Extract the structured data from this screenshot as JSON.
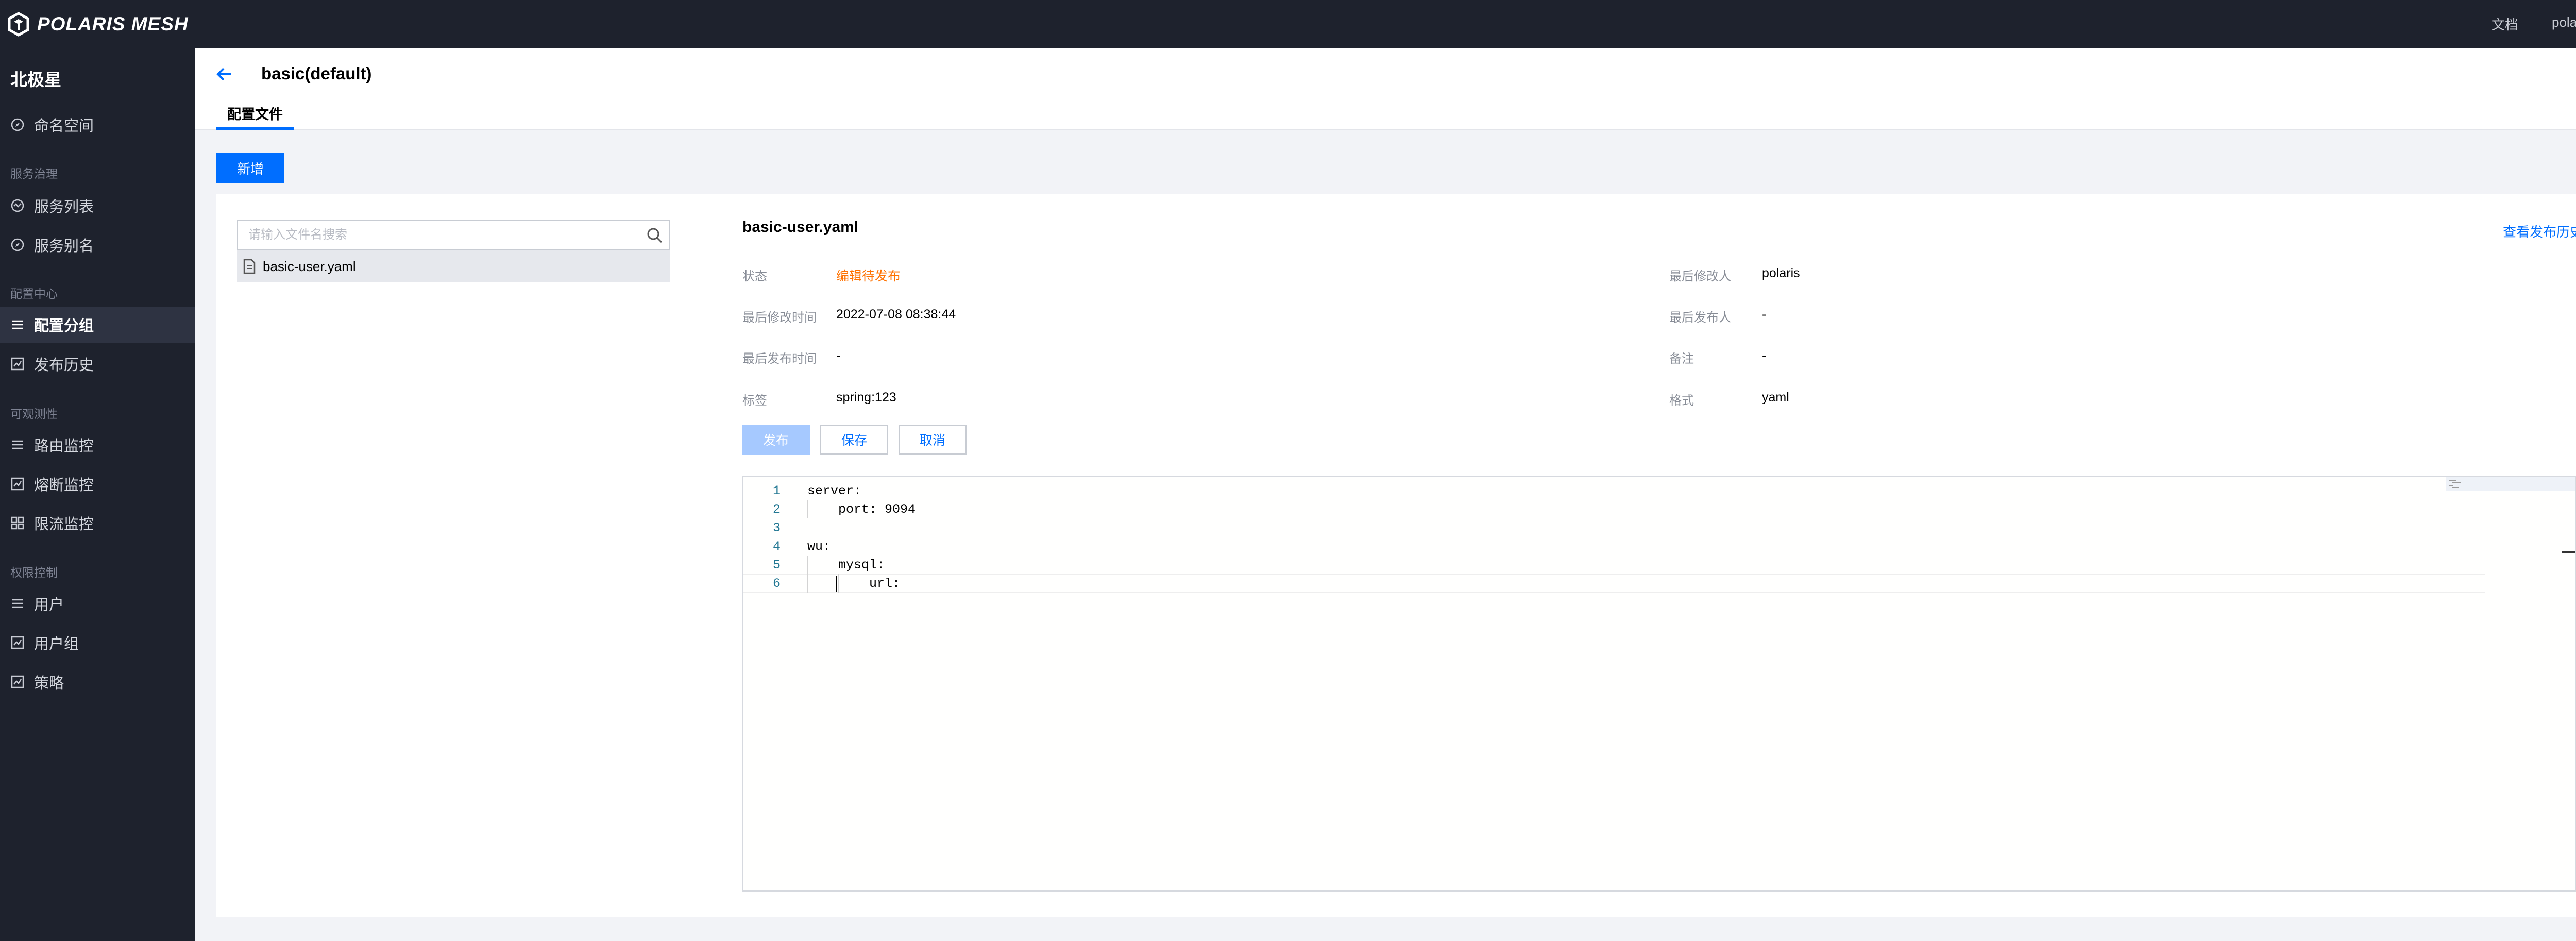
{
  "topbar": {
    "logo_text": "POLARIS MESH",
    "links": [
      "文档",
      "pola"
    ]
  },
  "sidebar": {
    "title": "北极星",
    "items": [
      {
        "label": "命名空间",
        "icon": "compass-icon",
        "section": null
      },
      {
        "label": "服务列表",
        "icon": "service-list-icon",
        "section": "服务治理"
      },
      {
        "label": "服务别名",
        "icon": "compass-icon",
        "section": null
      },
      {
        "label": "配置分组",
        "icon": "menu-list-icon",
        "section": "配置中心",
        "active": true
      },
      {
        "label": "发布历史",
        "icon": "chart-box-icon",
        "section": null
      },
      {
        "label": "路由监控",
        "icon": "menu-list-icon",
        "section": "可观测性"
      },
      {
        "label": "熔断监控",
        "icon": "chart-box-icon",
        "section": null
      },
      {
        "label": "限流监控",
        "icon": "grid-icon",
        "section": null
      },
      {
        "label": "用户",
        "icon": "menu-list-icon",
        "section": "权限控制"
      },
      {
        "label": "用户组",
        "icon": "chart-box-icon",
        "section": null
      },
      {
        "label": "策略",
        "icon": "chart-box-icon",
        "section": null
      }
    ],
    "sections": [
      "服务治理",
      "配置中心",
      "可观测性",
      "权限控制"
    ]
  },
  "header": {
    "title": "basic(default)",
    "tab": "配置文件"
  },
  "toolbar": {
    "add_label": "新增"
  },
  "file_list": {
    "search_placeholder": "请输入文件名搜索",
    "files": [
      "basic-user.yaml"
    ]
  },
  "detail": {
    "file_name": "basic-user.yaml",
    "history_link": "查看发布历史",
    "fields": {
      "status_label": "状态",
      "status_value": "编辑待发布",
      "modified_time_label": "最后修改时间",
      "modified_time_value": "2022-07-08 08:38:44",
      "published_time_label": "最后发布时间",
      "published_time_value": "-",
      "tags_label": "标签",
      "tags_value": "spring:123",
      "modifier_label": "最后修改人",
      "modifier_value": "polaris",
      "publisher_label": "最后发布人",
      "publisher_value": "-",
      "comment_label": "备注",
      "comment_value": "-",
      "format_label": "格式",
      "format_value": "yaml"
    },
    "buttons": {
      "publish": "发布",
      "save": "保存",
      "cancel": "取消"
    }
  },
  "editor": {
    "lines": [
      {
        "n": "1",
        "text": "server:"
      },
      {
        "n": "2",
        "text": "    port: 9094"
      },
      {
        "n": "3",
        "text": ""
      },
      {
        "n": "4",
        "text": "wu:"
      },
      {
        "n": "5",
        "text": "    mysql:"
      },
      {
        "n": "6",
        "text": "        url:"
      }
    ]
  },
  "colors": {
    "accent": "#006eff",
    "sidebar_bg": "#1e222d",
    "status_orange": "#ff7200"
  }
}
